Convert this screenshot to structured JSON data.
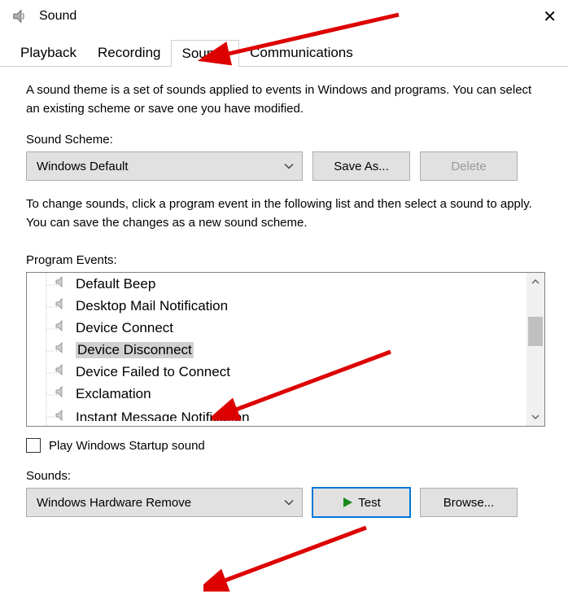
{
  "window": {
    "title": "Sound",
    "close": "✕"
  },
  "tabs": {
    "playback": "Playback",
    "recording": "Recording",
    "sounds": "Sounds",
    "communications": "Communications"
  },
  "intro": "A sound theme is a set of sounds applied to events in Windows and programs.  You can select an existing scheme or save one you have modified.",
  "scheme": {
    "label": "Sound Scheme:",
    "value": "Windows Default"
  },
  "buttons": {
    "save_as": "Save As...",
    "delete": "Delete",
    "test": "Test",
    "browse": "Browse..."
  },
  "change_text": "To change sounds, click a program event in the following list and then select a sound to apply.  You can save the changes as a new sound scheme.",
  "events": {
    "label": "Program Events:",
    "items": [
      "Default Beep",
      "Desktop Mail Notification",
      "Device Connect",
      "Device Disconnect",
      "Device Failed to Connect",
      "Exclamation",
      "Instant Message Notification"
    ],
    "selected_index": 3
  },
  "startup_checkbox": "Play Windows Startup sound",
  "sounds": {
    "label": "Sounds:",
    "value": "Windows Hardware Remove"
  }
}
